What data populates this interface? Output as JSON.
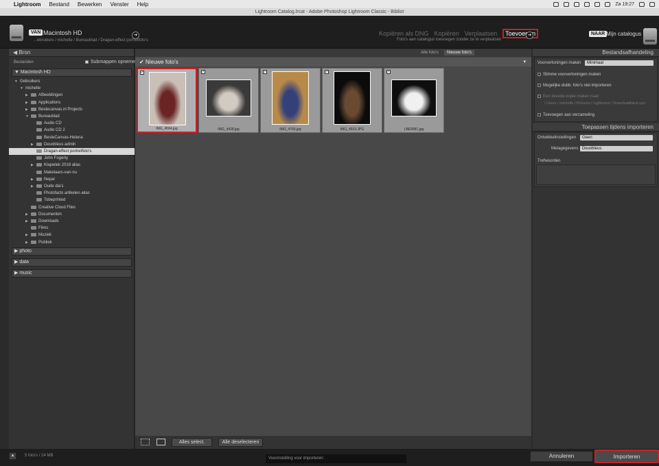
{
  "menubar": {
    "apple": "",
    "app": "Lightroom",
    "items": [
      "Bestand",
      "Bewerken",
      "Venster",
      "Help"
    ],
    "clock": "Za 19:27"
  },
  "titlebar": {
    "title": "Lightroom Catalog.lrcat - Adobe Photoshop Lightroom Classic - Bibliot"
  },
  "header": {
    "from_badge": "VAN",
    "source_name": "Macintosh HD",
    "source_path": "...ebruikers / michelle / Bureaublad / Dragan-effect portretfoto's",
    "modes": [
      "Kopiëren als DNG",
      "Kopiëren",
      "Verplaatsen",
      "Toevoegen"
    ],
    "active_mode": "Toevoegen",
    "mode_desc": "Foto's aan catalogus toevoegen zonder ze te verplaatsen",
    "to_badge": "NAAR",
    "dest_name": "Mijn catalogus"
  },
  "left": {
    "title": "Bron",
    "files_label": "Bestanden",
    "subfolders_label": "Submappen opnemen",
    "volume": "Macintosh HD",
    "tree": [
      {
        "label": "Gebruikers",
        "indent": 0,
        "tri": "▼",
        "folder": false
      },
      {
        "label": "michelle",
        "indent": 1,
        "tri": "▼",
        "folder": false
      },
      {
        "label": "Afbeeldingen",
        "indent": 2,
        "tri": "▶",
        "folder": true
      },
      {
        "label": "Applications",
        "indent": 2,
        "tri": "▶",
        "folder": true
      },
      {
        "label": "Bestecanvas.nl Projects",
        "indent": 2,
        "tri": "▶",
        "folder": true
      },
      {
        "label": "Bureaublad",
        "indent": 2,
        "tri": "▼",
        "folder": true
      },
      {
        "label": "Audio CD",
        "indent": 3,
        "tri": "",
        "folder": true
      },
      {
        "label": "Audio CD 2",
        "indent": 3,
        "tri": "",
        "folder": true
      },
      {
        "label": "BesteCanvas-Helena",
        "indent": 3,
        "tri": "",
        "folder": true
      },
      {
        "label": "Deuxbleus admin",
        "indent": 3,
        "tri": "▶",
        "folder": true
      },
      {
        "label": "Dragan-effect portretfoto's",
        "indent": 3,
        "tri": "",
        "folder": true,
        "selected": true
      },
      {
        "label": "John Fogerty",
        "indent": 3,
        "tri": "",
        "folder": true
      },
      {
        "label": "Klapwiek 2018 alias",
        "indent": 3,
        "tri": "▶",
        "folder": true
      },
      {
        "label": "Makelaars-van-nu",
        "indent": 3,
        "tri": "",
        "folder": true
      },
      {
        "label": "Nepal",
        "indent": 3,
        "tri": "▶",
        "folder": true
      },
      {
        "label": "Oude dia's",
        "indent": 3,
        "tri": "▶",
        "folder": true
      },
      {
        "label": "Photofacts artikelen alias",
        "indent": 3,
        "tri": "",
        "folder": true
      },
      {
        "label": "Tobeprinted",
        "indent": 3,
        "tri": "",
        "folder": true
      },
      {
        "label": "Creative Cloud Files",
        "indent": 2,
        "tri": "",
        "folder": true
      },
      {
        "label": "Documenten",
        "indent": 2,
        "tri": "▶",
        "folder": true
      },
      {
        "label": "Downloads",
        "indent": 2,
        "tri": "▶",
        "folder": true
      },
      {
        "label": "Films",
        "indent": 2,
        "tri": "",
        "folder": true
      },
      {
        "label": "Muziek",
        "indent": 2,
        "tri": "▶",
        "folder": true
      },
      {
        "label": "Publiek",
        "indent": 2,
        "tri": "▶",
        "folder": true
      }
    ],
    "volumes": [
      "photo",
      "data",
      "music"
    ]
  },
  "center": {
    "tab_all": "Alle foto's",
    "tab_new": "Nieuwe foto's",
    "section": "Nieuwe foto's",
    "photos": [
      {
        "name": "IMG_4564.jpg",
        "bg": "#c9bfb6",
        "subject": "#6b2424",
        "selected": true
      },
      {
        "name": "IMG_4428.jpg",
        "bg": "#3a3a3a",
        "subject": "#d2cbc2",
        "selected": false
      },
      {
        "name": "IMG_4766.jpg",
        "bg": "#b88a4a",
        "subject": "#33407a",
        "selected": false
      },
      {
        "name": "IMG_4919.JPG",
        "bg": "#0b0b0b",
        "subject": "#6a4a32",
        "selected": false
      },
      {
        "name": "LBE9581.jpg",
        "bg": "#0e0e0e",
        "subject": "#f0f0f0",
        "selected": false
      }
    ],
    "select_all": "Alles select.",
    "deselect_all": "Alle deselecteren"
  },
  "right": {
    "file_handling_title": "Bestandsafhandeling",
    "previews_label": "Voorvertoningen maken",
    "previews_value": "Minimaal",
    "smart_previews": "Slimme voorvertoningen maken",
    "no_duplicates": "Mogelijke dubb. foto's niet importeren",
    "second_copy": "Een tweede kopie maken naar:",
    "second_copy_path": "/ Users / michelle / Pictures / Lightroom / Downloadback-ups",
    "add_to_collection": "Toevoegen aan verzameling",
    "apply_title": "Toepassen tijdens importeren",
    "develop_label": "Ontwikkelinstellingen",
    "develop_value": "Geen",
    "metadata_label": "Metagegevens",
    "metadata_value": "Deuxbleus",
    "keywords_label": "Trefwoorden"
  },
  "footer": {
    "status": "5 foto's / 24 MB",
    "preset": "Voorinstelling voor importeren:",
    "cancel": "Annuleren",
    "import": "Importeren"
  },
  "colors": {
    "accent_red": "#c8202a"
  }
}
